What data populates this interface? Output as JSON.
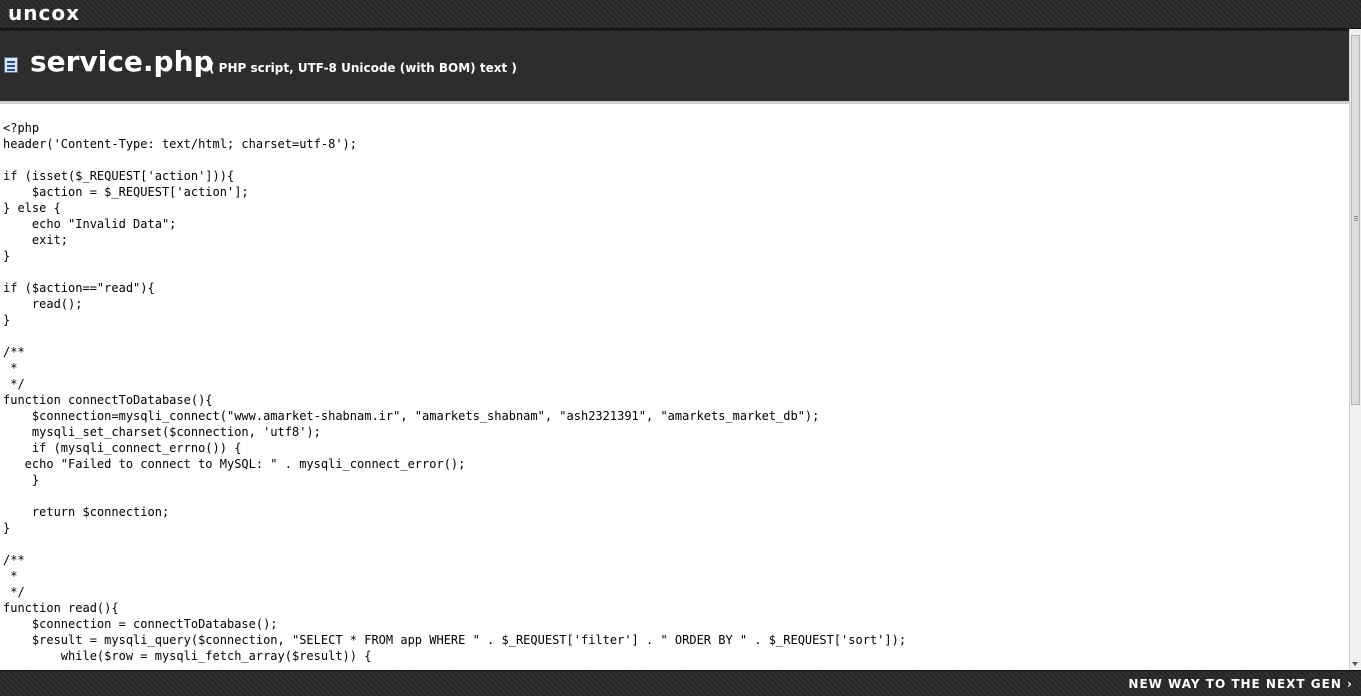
{
  "brand": {
    "logo_text": "uncox"
  },
  "header": {
    "file_icon": "file-icon",
    "file_name": "service.php",
    "file_meta": "( PHP script, UTF-8 Unicode (with BOM) text )"
  },
  "code": {
    "text": "<?php\nheader('Content-Type: text/html; charset=utf-8');\n\nif (isset($_REQUEST['action'])){\n    $action = $_REQUEST['action'];\n} else {\n    echo \"Invalid Data\";\n    exit;\n}\n\nif ($action==\"read\"){\n    read();\n}\n\n/**\n *\n */\nfunction connectToDatabase(){\n    $connection=mysqli_connect(\"www.amarket-shabnam.ir\", \"amarkets_shabnam\", \"ash2321391\", \"amarkets_market_db\");\n    mysqli_set_charset($connection, 'utf8');\n    if (mysqli_connect_errno()) {\n   echo \"Failed to connect to MySQL: \" . mysqli_connect_error();\n    }\n\n    return $connection;\n}\n\n/**\n *\n */\nfunction read(){\n    $connection = connectToDatabase();\n    $result = mysqli_query($connection, \"SELECT * FROM app WHERE \" . $_REQUEST['filter'] . \" ORDER BY \" . $_REQUEST['sort']);\n        while($row = mysqli_fetch_array($result)) {"
  },
  "footer": {
    "tagline": "NEW WAY TO THE NEXT GEN ›"
  }
}
